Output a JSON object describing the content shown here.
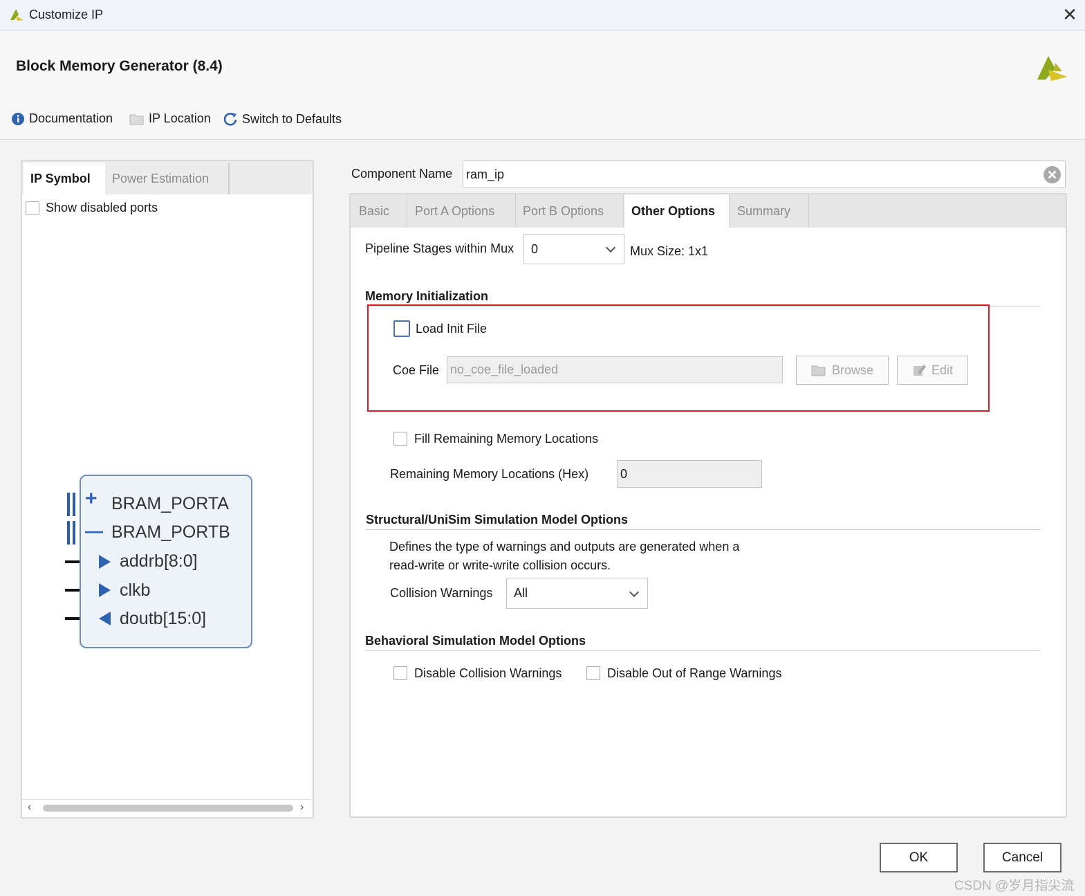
{
  "window": {
    "title": "Customize IP",
    "close_glyph": "✕"
  },
  "header": {
    "title": "Block Memory Generator (8.4)",
    "toolbar": {
      "documentation": "Documentation",
      "ip_location": "IP Location",
      "switch_defaults": "Switch to Defaults"
    }
  },
  "left_panel": {
    "tabs": [
      {
        "label": "IP Symbol",
        "active": true
      },
      {
        "label": "Power Estimation",
        "active": false
      }
    ],
    "show_disabled_ports": {
      "label": "Show disabled ports",
      "checked": false
    },
    "symbol": {
      "ports": [
        {
          "label": "BRAM_PORTA",
          "kind": "bus",
          "expander": "+"
        },
        {
          "label": "BRAM_PORTB",
          "kind": "bus",
          "expander": "—"
        },
        {
          "label": "addrb[8:0]",
          "dir": "in"
        },
        {
          "label": "clkb",
          "dir": "in"
        },
        {
          "label": "doutb[15:0]",
          "dir": "out"
        }
      ]
    }
  },
  "component_name": {
    "label": "Component Name",
    "value": "ram_ip"
  },
  "right_tabs": [
    {
      "label": "Basic",
      "active": false
    },
    {
      "label": "Port A Options",
      "active": false
    },
    {
      "label": "Port B Options",
      "active": false
    },
    {
      "label": "Other Options",
      "active": true
    },
    {
      "label": "Summary",
      "active": false
    }
  ],
  "other_options": {
    "pipeline": {
      "label": "Pipeline Stages within Mux",
      "value": "0",
      "mux_size": "Mux Size: 1x1"
    },
    "memory_init": {
      "section": "Memory Initialization",
      "load_init": {
        "label": "Load Init File",
        "checked": false
      },
      "coe_label": "Coe File",
      "coe_value": "no_coe_file_loaded",
      "browse": "Browse",
      "edit": "Edit",
      "highlight_color": "#d9202a"
    },
    "fill_remaining": {
      "label": "Fill Remaining Memory Locations",
      "checked": false
    },
    "remaining_hex": {
      "label": "Remaining Memory Locations (Hex)",
      "value": "0"
    },
    "structural": {
      "section": "Structural/UniSim Simulation Model Options",
      "desc1": "Defines the type of warnings and outputs are generated when a",
      "desc2": "read-write or write-write collision occurs.",
      "collision_label": "Collision Warnings",
      "collision_value": "All"
    },
    "behavioral": {
      "section": "Behavioral Simulation Model Options",
      "disable_collision": "Disable Collision Warnings",
      "disable_range": "Disable Out of Range Warnings"
    }
  },
  "footer": {
    "ok": "OK",
    "cancel": "Cancel"
  },
  "watermark": "CSDN @岁月指尖流",
  "colors": {
    "accent": "#2f62b0",
    "logo_green": "#8fa81c",
    "logo_yellow": "#d8c32a"
  }
}
